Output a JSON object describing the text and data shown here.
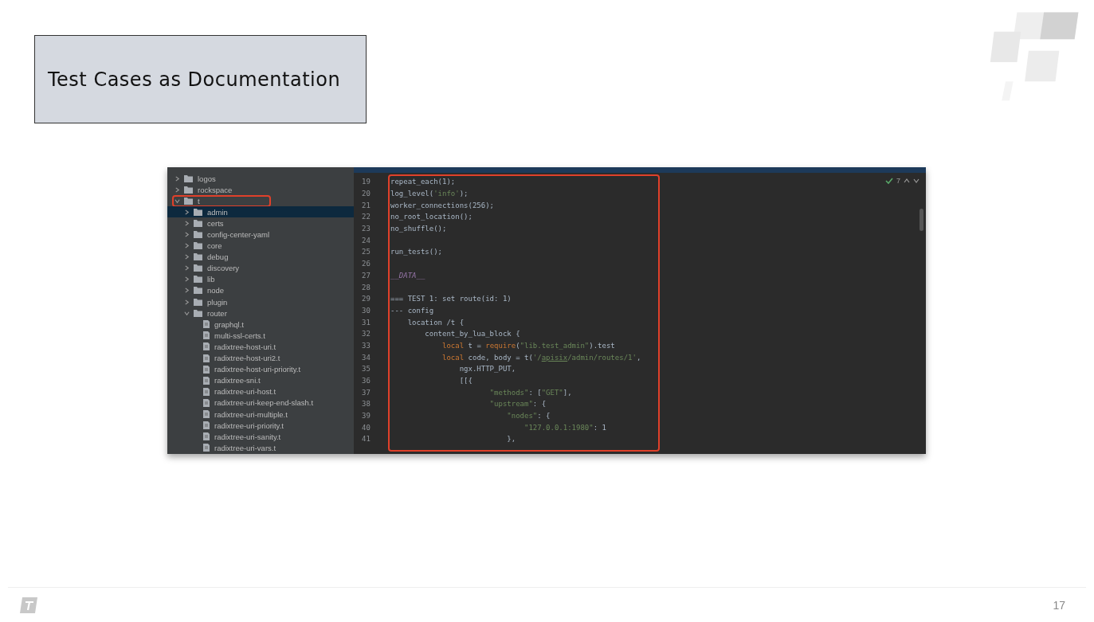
{
  "slide": {
    "title": "Test Cases as Documentation",
    "page_number": "17"
  },
  "project_tree": [
    {
      "label": "logos",
      "kind": "folder",
      "expanded": false,
      "selected": false
    },
    {
      "label": "rockspace",
      "kind": "folder",
      "expanded": false,
      "selected": false
    },
    {
      "label": "t",
      "kind": "folder",
      "expanded": true,
      "selected": false,
      "highlighted": true,
      "children": [
        {
          "label": "admin",
          "kind": "folder",
          "expanded": false,
          "selected": true
        },
        {
          "label": "certs",
          "kind": "folder",
          "expanded": false,
          "selected": false
        },
        {
          "label": "config-center-yaml",
          "kind": "folder",
          "expanded": false,
          "selected": false
        },
        {
          "label": "core",
          "kind": "folder",
          "expanded": false,
          "selected": false
        },
        {
          "label": "debug",
          "kind": "folder",
          "expanded": false,
          "selected": false
        },
        {
          "label": "discovery",
          "kind": "folder",
          "expanded": false,
          "selected": false
        },
        {
          "label": "lib",
          "kind": "folder",
          "expanded": false,
          "selected": false
        },
        {
          "label": "node",
          "kind": "folder",
          "expanded": false,
          "selected": false
        },
        {
          "label": "plugin",
          "kind": "folder",
          "expanded": false,
          "selected": false
        },
        {
          "label": "router",
          "kind": "folder",
          "expanded": true,
          "selected": false,
          "children": [
            {
              "label": "graphql.t",
              "kind": "file",
              "selected": false
            },
            {
              "label": "multi-ssl-certs.t",
              "kind": "file",
              "selected": false
            },
            {
              "label": "radixtree-host-uri.t",
              "kind": "file",
              "selected": false
            },
            {
              "label": "radixtree-host-uri2.t",
              "kind": "file",
              "selected": false
            },
            {
              "label": "radixtree-host-uri-priority.t",
              "kind": "file",
              "selected": false
            },
            {
              "label": "radixtree-sni.t",
              "kind": "file",
              "selected": false
            },
            {
              "label": "radixtree-uri-host.t",
              "kind": "file",
              "selected": false
            },
            {
              "label": "radixtree-uri-keep-end-slash.t",
              "kind": "file",
              "selected": false
            },
            {
              "label": "radixtree-uri-multiple.t",
              "kind": "file",
              "selected": false
            },
            {
              "label": "radixtree-uri-priority.t",
              "kind": "file",
              "selected": false
            },
            {
              "label": "radixtree-uri-sanity.t",
              "kind": "file",
              "selected": false
            },
            {
              "label": "radixtree-uri-vars.t",
              "kind": "file",
              "selected": false
            }
          ]
        }
      ]
    }
  ],
  "editor": {
    "inspection_count": "7",
    "lines": [
      {
        "number": "19",
        "tokens": [
          {
            "text": "repeat_each(1);",
            "kind": "plain"
          }
        ]
      },
      {
        "number": "20",
        "tokens": [
          {
            "text": "log_level(",
            "kind": "plain"
          },
          {
            "text": "'info'",
            "kind": "string"
          },
          {
            "text": ");",
            "kind": "plain"
          }
        ]
      },
      {
        "number": "21",
        "tokens": [
          {
            "text": "worker_connections(256);",
            "kind": "plain"
          }
        ]
      },
      {
        "number": "22",
        "tokens": [
          {
            "text": "no_root_location();",
            "kind": "plain"
          }
        ]
      },
      {
        "number": "23",
        "tokens": [
          {
            "text": "no_shuffle();",
            "kind": "plain"
          }
        ]
      },
      {
        "number": "24"
      },
      {
        "number": "25",
        "tokens": [
          {
            "text": "run_tests();",
            "kind": "plain"
          }
        ]
      },
      {
        "number": "26"
      },
      {
        "number": "27",
        "tokens": [
          {
            "text": "__DATA__",
            "kind": "meta"
          }
        ]
      },
      {
        "number": "28"
      },
      {
        "number": "29",
        "tokens": [
          {
            "text": "=== TEST 1: set route(id: 1)",
            "kind": "plain"
          }
        ]
      },
      {
        "number": "30",
        "tokens": [
          {
            "text": "--- config",
            "kind": "plain"
          }
        ]
      },
      {
        "number": "31",
        "tokens": [
          {
            "text": "    location /t {",
            "kind": "plain"
          }
        ]
      },
      {
        "number": "32",
        "tokens": [
          {
            "text": "        content_by_lua_block {",
            "kind": "plain"
          }
        ]
      },
      {
        "number": "33",
        "tokens": [
          {
            "text": "            local",
            "kind": "keyword"
          },
          {
            "text": " t = ",
            "kind": "plain"
          },
          {
            "text": "require",
            "kind": "keyword"
          },
          {
            "text": "(",
            "kind": "plain"
          },
          {
            "text": "\"lib.test_admin\"",
            "kind": "string"
          },
          {
            "text": ").test",
            "kind": "plain"
          }
        ]
      },
      {
        "number": "34",
        "tokens": [
          {
            "text": "            local",
            "kind": "keyword"
          },
          {
            "text": " code, body = t(",
            "kind": "plain"
          },
          {
            "text": "'/",
            "kind": "string"
          },
          {
            "text": "apisix",
            "kind": "typo"
          },
          {
            "text": "/admin/routes/1'",
            "kind": "string"
          },
          {
            "text": ",",
            "kind": "plain"
          }
        ]
      },
      {
        "number": "35",
        "tokens": [
          {
            "text": "                ngx.HTTP_PUT,",
            "kind": "plain"
          }
        ]
      },
      {
        "number": "36",
        "tokens": [
          {
            "text": "                [[{",
            "kind": "plain"
          }
        ]
      },
      {
        "number": "37",
        "tokens": [
          {
            "text": "                       \"methods\"",
            "kind": "string"
          },
          {
            "text": ": [",
            "kind": "plain"
          },
          {
            "text": "\"GET\"",
            "kind": "string"
          },
          {
            "text": "],",
            "kind": "plain"
          }
        ]
      },
      {
        "number": "38",
        "tokens": [
          {
            "text": "                       \"upstream\"",
            "kind": "string"
          },
          {
            "text": ": {",
            "kind": "plain"
          }
        ]
      },
      {
        "number": "39",
        "tokens": [
          {
            "text": "                           \"nodes\"",
            "kind": "string"
          },
          {
            "text": ": {",
            "kind": "plain"
          }
        ]
      },
      {
        "number": "40",
        "tokens": [
          {
            "text": "                               \"127.0.0.1:1980\"",
            "kind": "string"
          },
          {
            "text": ": 1",
            "kind": "plain"
          }
        ]
      },
      {
        "number": "41",
        "tokens": [
          {
            "text": "                           },",
            "kind": "plain"
          }
        ]
      }
    ]
  }
}
